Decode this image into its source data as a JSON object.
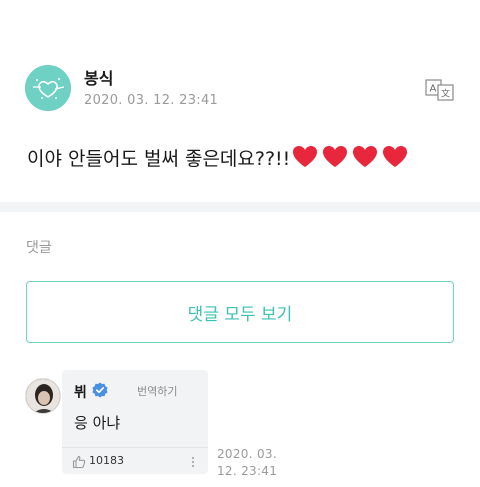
{
  "post": {
    "author": "봉식",
    "date": "2020. 03. 12. 23:41",
    "text": "이야 안들어도 벌써 좋은데요??!!",
    "avatar_icon": "heart-logo-icon",
    "translate_icon": "translate-icon",
    "heart_emoji_count": 4
  },
  "comments": {
    "label": "댓글",
    "view_all_label": "댓글 모두 보기"
  },
  "reply": {
    "author": "뷔",
    "verified_icon": "verified-badge-icon",
    "translate_label": "번역하기",
    "text": "응 아냐",
    "like_icon": "thumbs-up-icon",
    "like_count": "10183",
    "more_icon": "more-vertical-icon",
    "date": "2020. 03. 12. 23:41"
  },
  "colors": {
    "accent": "#3cc1b2",
    "accent_border": "#6fd3c7",
    "bubble_bg": "#f2f3f5",
    "muted": "#9a9a9a",
    "heart": "#e8263c"
  }
}
